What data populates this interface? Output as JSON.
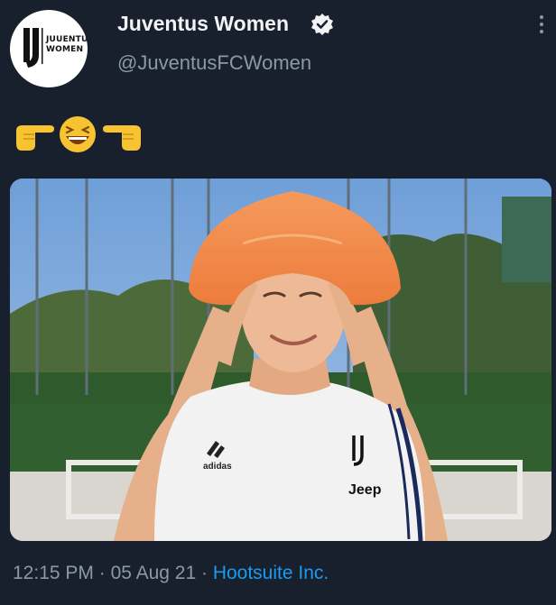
{
  "tweet": {
    "display_name": "Juventus Women",
    "handle": "@JuventusFCWomen",
    "avatar_text_line1": "JUUENTUS",
    "avatar_text_line2": "WOMEN",
    "verified_icon": "verified-badge-icon",
    "more_icon": "more-vertical-icon",
    "emojis": [
      "pointing-right-hand-emoji",
      "laughing-face-emoji",
      "pointing-left-hand-emoji"
    ],
    "photo_shirt_text": "Jeep",
    "photo_brand_text": "adidas",
    "time": "12:15 PM",
    "separator": " · ",
    "date": "05 Aug 21",
    "separator2": " · ",
    "source": "Hootsuite Inc."
  },
  "colors": {
    "background": "#17202c",
    "name": "#f2f3f5",
    "secondary": "#8b98a5",
    "link": "#1d9bf0",
    "hat": "#f08a4b"
  }
}
